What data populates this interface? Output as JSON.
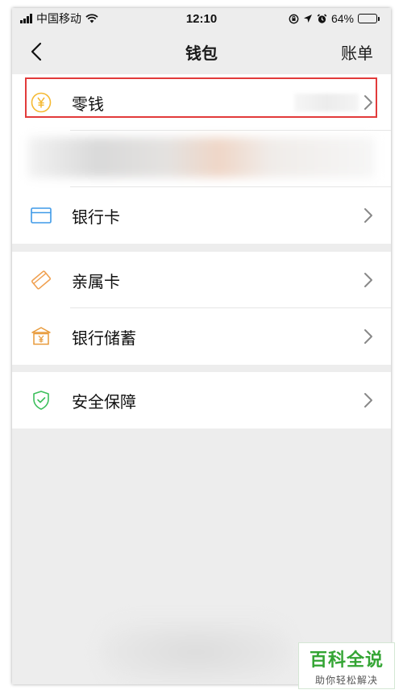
{
  "status_bar": {
    "carrier": "中国移动",
    "time": "12:10",
    "battery_percent": "64%",
    "battery_level": 0.64
  },
  "nav": {
    "title": "钱包",
    "action": "账单"
  },
  "groups": [
    {
      "items": [
        {
          "label": "零钱",
          "icon": "coin-icon",
          "highlighted": true
        },
        {
          "label": "",
          "icon": "",
          "blurred": true
        },
        {
          "label": "银行卡",
          "icon": "card-icon"
        }
      ]
    },
    {
      "items": [
        {
          "label": "亲属卡",
          "icon": "family-card-icon"
        },
        {
          "label": "银行储蓄",
          "icon": "bank-icon"
        }
      ]
    },
    {
      "items": [
        {
          "label": "安全保障",
          "icon": "shield-icon"
        }
      ]
    }
  ],
  "watermark": {
    "title": "百科全说",
    "subtitle": "助你轻松解决"
  },
  "colors": {
    "coin": "#f5b932",
    "card": "#3f9ae8",
    "family_card": "#f0a050",
    "bank": "#e89a3a",
    "shield": "#3cbf5c",
    "highlight": "#e23b3b",
    "watermark": "#34a534"
  }
}
